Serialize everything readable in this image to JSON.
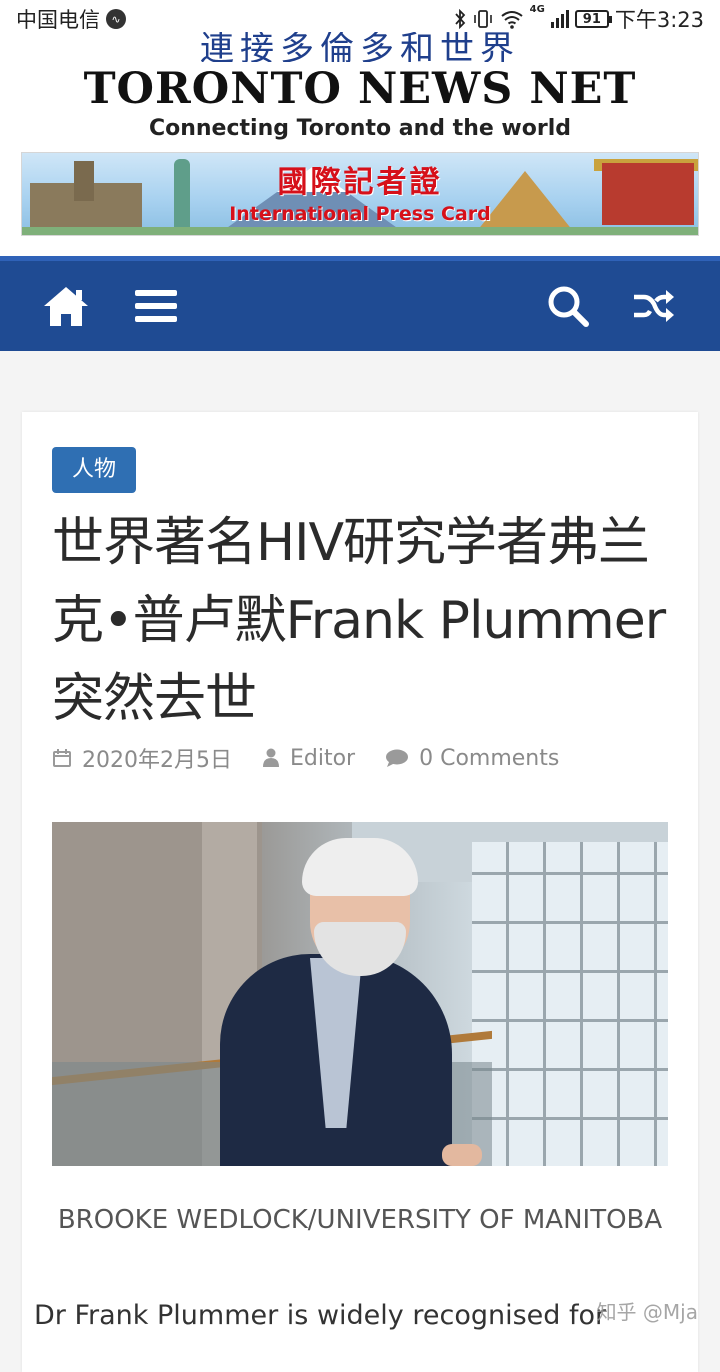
{
  "status_bar": {
    "carrier": "中国电信",
    "time": "下午3:23",
    "battery": "91",
    "network": "4G"
  },
  "header": {
    "chinese_slogan": "連接多倫多和世界",
    "site_title": "TORONTO NEWS NET",
    "tagline": "Connecting Toronto and the world",
    "banner": {
      "title_cn": "國際記者證",
      "title_en": "International Press Card"
    }
  },
  "nav": {
    "icons": [
      "home-icon",
      "menu-icon",
      "search-icon",
      "shuffle-icon"
    ],
    "color": "#1f4b93"
  },
  "article": {
    "category": "人物",
    "title": "世界著名HIV研究学者弗兰克•普卢默Frank Plummer突然去世",
    "date": "2020年2月5日",
    "author": "Editor",
    "comments": "0 Comments",
    "image_caption": "BROOKE WEDLOCK/UNIVERSITY OF MANITOBA",
    "body_start": "Dr Frank Plummer is widely recognised for"
  },
  "watermark": "知乎 @Mja"
}
